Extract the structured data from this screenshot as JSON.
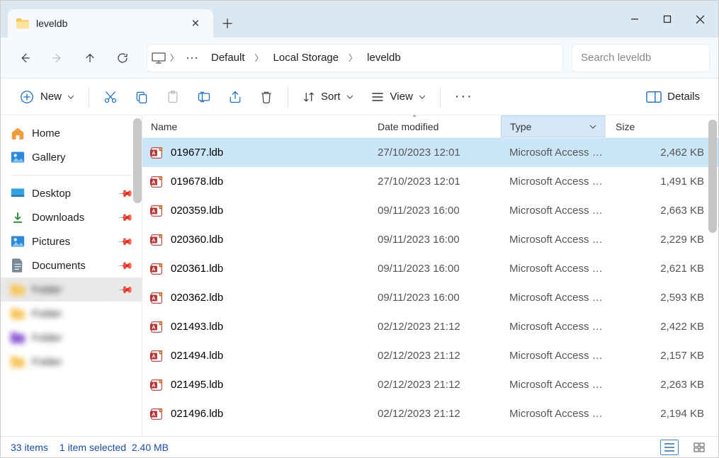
{
  "tab": {
    "title": "leveldb"
  },
  "breadcrumbs": {
    "seg1": "Default",
    "seg2": "Local Storage",
    "seg3": "leveldb"
  },
  "search": {
    "placeholder": "Search leveldb"
  },
  "toolbar": {
    "new_label": "New",
    "sort_label": "Sort",
    "view_label": "View",
    "details_label": "Details"
  },
  "sidebar": {
    "items": [
      {
        "label": "Home",
        "icon": "home",
        "pin": false
      },
      {
        "label": "Gallery",
        "icon": "gallery",
        "pin": false
      },
      {
        "label": "Desktop",
        "icon": "desktop",
        "pin": true
      },
      {
        "label": "Downloads",
        "icon": "downloads",
        "pin": true
      },
      {
        "label": "Pictures",
        "icon": "pictures",
        "pin": true
      },
      {
        "label": "Documents",
        "icon": "documents",
        "pin": true
      }
    ]
  },
  "columns": {
    "name": "Name",
    "date": "Date modified",
    "type": "Type",
    "size": "Size"
  },
  "files": [
    {
      "name": "019677.ldb",
      "date": "27/10/2023 12:01",
      "type": "Microsoft Access R...",
      "size": "2,462 KB",
      "selected": true
    },
    {
      "name": "019678.ldb",
      "date": "27/10/2023 12:01",
      "type": "Microsoft Access R...",
      "size": "1,491 KB"
    },
    {
      "name": "020359.ldb",
      "date": "09/11/2023 16:00",
      "type": "Microsoft Access R...",
      "size": "2,663 KB"
    },
    {
      "name": "020360.ldb",
      "date": "09/11/2023 16:00",
      "type": "Microsoft Access R...",
      "size": "2,229 KB"
    },
    {
      "name": "020361.ldb",
      "date": "09/11/2023 16:00",
      "type": "Microsoft Access R...",
      "size": "2,621 KB"
    },
    {
      "name": "020362.ldb",
      "date": "09/11/2023 16:00",
      "type": "Microsoft Access R...",
      "size": "2,593 KB"
    },
    {
      "name": "021493.ldb",
      "date": "02/12/2023 21:12",
      "type": "Microsoft Access R...",
      "size": "2,422 KB"
    },
    {
      "name": "021494.ldb",
      "date": "02/12/2023 21:12",
      "type": "Microsoft Access R...",
      "size": "2,157 KB"
    },
    {
      "name": "021495.ldb",
      "date": "02/12/2023 21:12",
      "type": "Microsoft Access R...",
      "size": "2,263 KB"
    },
    {
      "name": "021496.ldb",
      "date": "02/12/2023 21:12",
      "type": "Microsoft Access R...",
      "size": "2,194 KB"
    }
  ],
  "status": {
    "count": "33 items",
    "selection": "1 item selected",
    "size": "2.40 MB"
  }
}
